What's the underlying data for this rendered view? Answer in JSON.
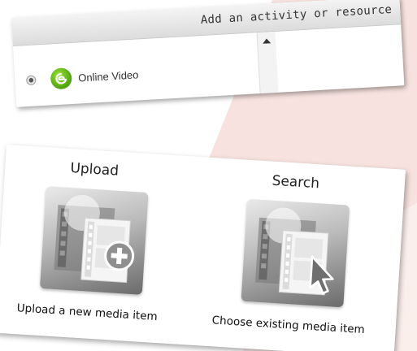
{
  "activity_panel": {
    "header_title": "Add an activity or resource",
    "options": [
      {
        "label": "Online Video",
        "icon": "online-video-icon",
        "icon_color": "#5cb512",
        "selected": false
      }
    ]
  },
  "media_options": {
    "upload": {
      "title": "Upload",
      "caption": "Upload a new media item",
      "icon": "film-plus-icon"
    },
    "search": {
      "title": "Search",
      "caption": "Choose existing media item",
      "icon": "film-cursor-icon"
    }
  },
  "colors": {
    "background_accent": "#f7e2df",
    "header_gray": "#e4e4e4",
    "tile_dark": "#6b6b6b"
  }
}
